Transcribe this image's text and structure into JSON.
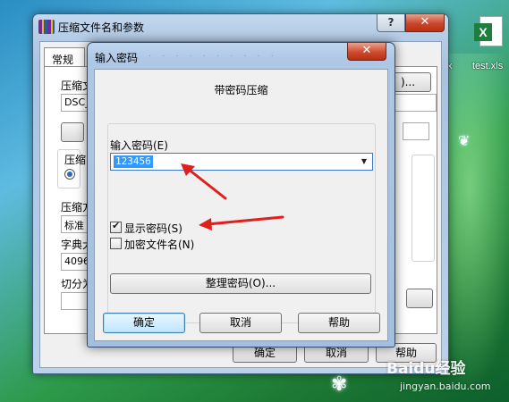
{
  "desktop": {
    "icon_file": "test.xls",
    "icon_glyph": "X",
    "partial_label": "x",
    "watermark": "Baidu经验",
    "watermark_url": "jingyan.baidu.com"
  },
  "outer_window": {
    "title": "压缩文件名和参数",
    "help_glyph": "?",
    "close_glyph": "✕",
    "tab": "常规",
    "label_archive": "压缩文",
    "archive_value": "DSC_",
    "browse": ")...",
    "label_format": "压缩",
    "label_method": "压缩方",
    "method_value": "标准",
    "label_dict": "字典大",
    "dict_value": "4096",
    "label_split": "切分为",
    "ok": "确定",
    "cancel": "取消",
    "help": "帮助"
  },
  "password_dialog": {
    "title": "输入密码",
    "heading": "带密码压缩",
    "password_label": "输入密码(E)",
    "password_value": "123456",
    "dropdown_glyph": "▼",
    "show_password_label": "显示密码(S)",
    "show_password_checked": true,
    "encrypt_names_label": "加密文件名(N)",
    "encrypt_names_checked": false,
    "organize_button": "整理密码(O)...",
    "ok": "确定",
    "cancel": "取消",
    "help": "帮助",
    "close_glyph": "✕"
  },
  "colors": {
    "annotation_arrow": "#e0201a",
    "selection": "#3399ff"
  }
}
